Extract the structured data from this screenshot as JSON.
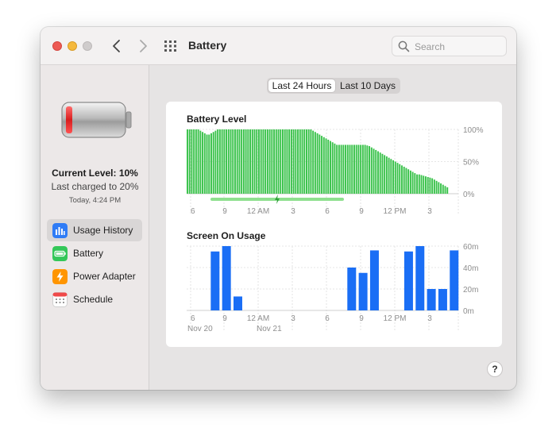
{
  "window": {
    "title": "Battery"
  },
  "search": {
    "placeholder": "Search"
  },
  "sidebar": {
    "current_level": "Current Level: 10%",
    "last_charged": "Last charged to 20%",
    "charged_time": "Today, 4:24 PM",
    "items": [
      {
        "label": "Usage History",
        "icon": "bar-chart-icon",
        "active": true,
        "color": "#2f7cf6"
      },
      {
        "label": "Battery",
        "icon": "battery-icon",
        "active": false,
        "color": "#34c759"
      },
      {
        "label": "Power Adapter",
        "icon": "lightning-icon",
        "active": false,
        "color": "#ff9500"
      },
      {
        "label": "Schedule",
        "icon": "calendar-icon",
        "active": false,
        "color": "#ffffff"
      }
    ]
  },
  "tabs": [
    {
      "label": "Last 24 Hours",
      "active": true
    },
    {
      "label": "Last 10 Days",
      "active": false
    }
  ],
  "colors": {
    "battery_green": "#39c24a",
    "charging_green": "#8fe08f",
    "usage_blue": "#1a6ef5"
  },
  "chart_data": [
    {
      "type": "bar",
      "title": "Battery Level",
      "x_tick_labels": [
        "6",
        "9",
        "12 AM",
        "3",
        "6",
        "9",
        "12 PM",
        "3"
      ],
      "y_tick_labels": [
        "100%",
        "50%",
        "0%"
      ],
      "ylim": [
        0,
        100
      ],
      "values": [
        100,
        100,
        100,
        100,
        100,
        100,
        98,
        96,
        94,
        92,
        92,
        94,
        96,
        98,
        100,
        100,
        100,
        100,
        100,
        100,
        100,
        100,
        100,
        100,
        100,
        100,
        100,
        100,
        100,
        100,
        100,
        100,
        100,
        100,
        100,
        100,
        100,
        100,
        100,
        100,
        100,
        100,
        100,
        100,
        100,
        100,
        100,
        100,
        100,
        100,
        100,
        100,
        100,
        100,
        100,
        100,
        100,
        100,
        98,
        96,
        94,
        92,
        90,
        88,
        86,
        84,
        82,
        80,
        78,
        76,
        76,
        76,
        76,
        76,
        76,
        76,
        76,
        76,
        76,
        76,
        76,
        76,
        76,
        75,
        74,
        72,
        70,
        68,
        66,
        64,
        62,
        60,
        58,
        56,
        54,
        52,
        50,
        48,
        46,
        44,
        42,
        40,
        38,
        36,
        34,
        32,
        30,
        30,
        29,
        28,
        27,
        26,
        25,
        24,
        22,
        20,
        18,
        16,
        14,
        12,
        10
      ],
      "grid": true,
      "charging_indicator": true
    },
    {
      "type": "bar",
      "title": "Screen On Usage",
      "x_tick_labels": [
        "6",
        "9",
        "12 AM",
        "3",
        "6",
        "9",
        "12 PM",
        "3"
      ],
      "date_labels": [
        "Nov 20",
        "Nov 21"
      ],
      "y_tick_labels": [
        "60m",
        "40m",
        "20m",
        "0m"
      ],
      "ylim": [
        0,
        60
      ],
      "values": [
        0,
        55,
        60,
        13,
        0,
        0,
        0,
        0,
        0,
        0,
        0,
        0,
        0,
        40,
        35,
        56,
        0,
        0,
        55,
        60,
        20,
        20,
        56
      ],
      "grid": true
    }
  ]
}
